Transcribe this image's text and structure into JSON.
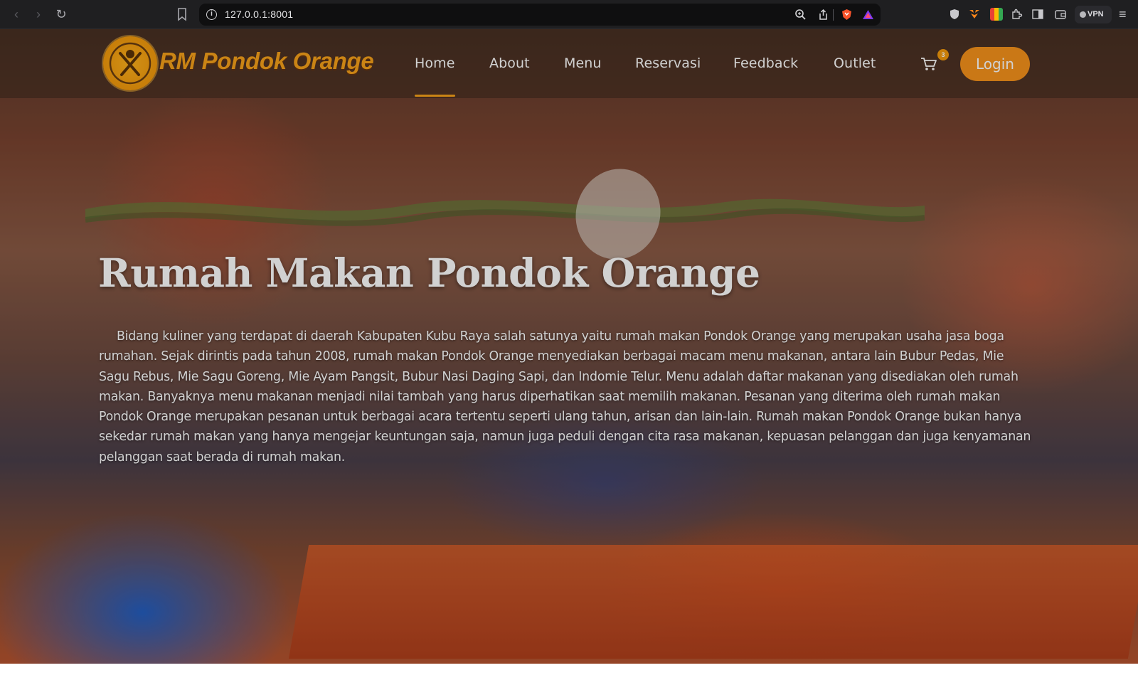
{
  "browser": {
    "url": "127.0.0.1:8001",
    "vpn_label": "VPN"
  },
  "site": {
    "logo_text": "RM Pondok Orange",
    "nav": [
      {
        "label": "Home",
        "active": true
      },
      {
        "label": "About",
        "active": false
      },
      {
        "label": "Menu",
        "active": false
      },
      {
        "label": "Reservasi",
        "active": false
      },
      {
        "label": "Feedback",
        "active": false
      },
      {
        "label": "Outlet",
        "active": false
      }
    ],
    "cart_count": "3",
    "login_label": "Login"
  },
  "hero": {
    "title": "Rumah Makan Pondok Orange",
    "description": "Bidang kuliner yang terdapat di daerah Kabupaten Kubu Raya salah satunya yaitu rumah makan Pondok Orange yang merupakan usaha jasa boga rumahan. Sejak dirintis pada tahun 2008, rumah makan Pondok Orange menyediakan berbagai macam menu makanan, antara lain Bubur Pedas, Mie Sagu Rebus, Mie Sagu Goreng, Mie Ayam Pangsit, Bubur Nasi Daging Sapi, dan Indomie Telur. Menu adalah daftar makanan yang disediakan oleh rumah makan. Banyaknya menu makanan menjadi nilai tambah yang harus diperhatikan saat memilih makanan. Pesanan yang diterima oleh rumah makan Pondok Orange merupakan pesanan untuk berbagai acara tertentu seperti ulang tahun, arisan dan lain-lain. Rumah makan Pondok Orange bukan hanya sekedar rumah makan yang hanya mengejar keuntungan saja, namun juga peduli dengan cita rasa makanan, kepuasan pelanggan dan juga kenyamanan pelanggan saat berada di rumah makan."
  },
  "colors": {
    "accent": "#f7931c",
    "browser_bg": "#1f1f21"
  },
  "icons": [
    "back-icon",
    "forward-icon",
    "reload-icon",
    "bookmark-icon",
    "info-icon",
    "zoom-icon",
    "share-icon",
    "brave-shield-icon",
    "brave-rewards-icon",
    "cart-icon",
    "logo-icon"
  ]
}
